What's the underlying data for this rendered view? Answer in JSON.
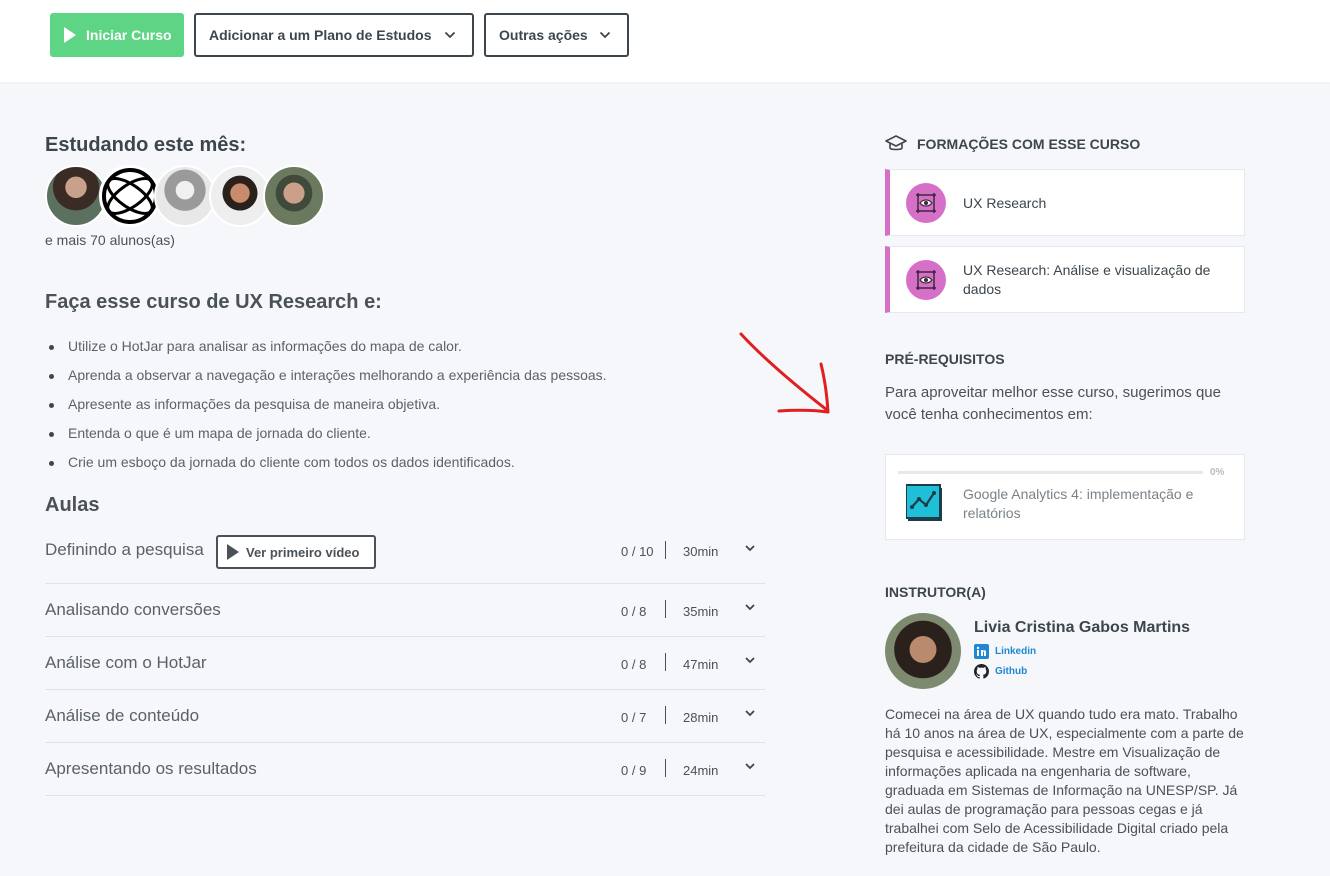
{
  "toolbar": {
    "start_label": "Iniciar Curso",
    "plan_label": "Adicionar a um Plano de Estudos",
    "other_label": "Outras ações"
  },
  "studying": {
    "heading": "Estudando este mês:",
    "more": "e mais 70 alunos(as)"
  },
  "course": {
    "heading": "Faça esse curso de UX Research e:",
    "benefits": [
      "Utilize o HotJar para analisar as informações do mapa de calor.",
      "Aprenda a observar a navegação e interações melhorando a experiência das pessoas.",
      "Apresente as informações da pesquisa de maneira objetiva.",
      "Entenda o que é um mapa de jornada do cliente.",
      "Crie um esboço da jornada do cliente com todos os dados identificados."
    ]
  },
  "lessons": {
    "heading": "Aulas",
    "video_button": "Ver primeiro vídeo",
    "items": [
      {
        "title": "Definindo a pesquisa",
        "count": "0 / 10",
        "duration": "30min"
      },
      {
        "title": "Analisando conversões",
        "count": "0 / 8",
        "duration": "35min"
      },
      {
        "title": "Análise com o HotJar",
        "count": "0 / 8",
        "duration": "47min"
      },
      {
        "title": "Análise de conteúdo",
        "count": "0 / 7",
        "duration": "28min"
      },
      {
        "title": "Apresentando os resultados",
        "count": "0 / 9",
        "duration": "24min"
      }
    ]
  },
  "formations": {
    "heading": "FORMAÇÕES COM ESSE CURSO",
    "items": [
      "UX Research",
      "UX Research: Análise e visualização de dados"
    ]
  },
  "prerequisites": {
    "heading": "PRÉ-REQUISITOS",
    "text": "Para aproveitar melhor esse curso, sugerimos que você tenha conhecimentos em:",
    "course": {
      "title": "Google Analytics 4: implementação e relatórios",
      "progress_label": "0%",
      "progress": 0
    }
  },
  "instructor": {
    "heading": "INSTRUTOR(A)",
    "name": "Livia Cristina Gabos Martins",
    "linkedin": "Linkedin",
    "github": "Github",
    "bio": "Comecei na área de UX quando tudo era mato. Trabalho há 10 anos na área de UX, especialmente com a parte de pesquisa e acessibilidade. Mestre em Visualização de informações aplicada na engenharia de software, graduada em Sistemas de Informação na UNESP/SP. Já dei aulas de programação para pessoas cegas e já trabalhei com Selo de Acessibilidade Digital criado pela prefeitura da cidade de São Paulo."
  },
  "colors": {
    "start_green": "#5ed585",
    "formation_pink": "#d66fc7",
    "link_blue": "#1e88d4",
    "annotation_red": "#e02020"
  },
  "icons": [
    "play-icon",
    "chevron-down-icon",
    "graduation-cap-icon",
    "eye-frame-icon",
    "analytics-chart-icon",
    "linkedin-icon",
    "github-icon"
  ]
}
